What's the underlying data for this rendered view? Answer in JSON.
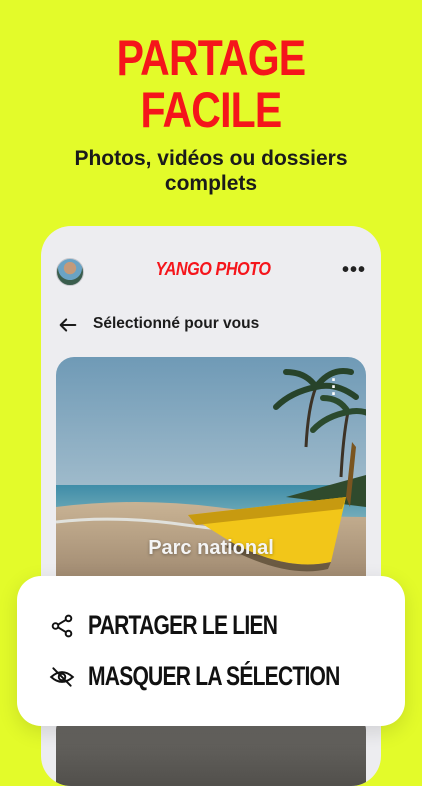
{
  "headline": {
    "line1": "PARTAGE",
    "line2": "FACILE"
  },
  "subheadline": "Photos, vidéos ou dossiers complets",
  "app": {
    "brand": "YANGO PHOTO",
    "more_icon": "more-horizontal-icon",
    "back_icon": "arrow-left-icon",
    "section_title": "Sélectionné pour vous",
    "card": {
      "title": "Parc national",
      "more_icon": "more-vertical-icon"
    }
  },
  "sheet": {
    "items": [
      {
        "label": "PARTAGER LE LIEN",
        "icon": "share-icon"
      },
      {
        "label": "MASQUER LA SÉLECTION",
        "icon": "eye-off-icon"
      }
    ]
  },
  "colors": {
    "background": "#e3fb2a",
    "accent": "#f5151b",
    "text": "#1b1b1b"
  }
}
